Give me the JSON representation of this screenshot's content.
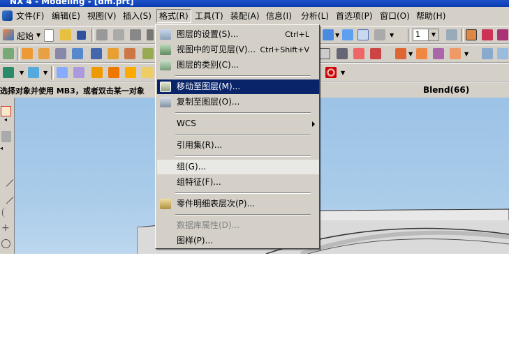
{
  "window": {
    "title": "NX 4 - Modeling - [dm.prt]"
  },
  "menubar": {
    "items": [
      "文件(F)",
      "编辑(E)",
      "视图(V)",
      "插入(S)",
      "格式(R)",
      "工具(T)",
      "装配(A)",
      "信息(I)",
      "分析(L)",
      "首选项(P)",
      "窗口(O)",
      "帮助(H)"
    ],
    "open_item": "格式(R)"
  },
  "toolbar1": {
    "start_label": "起始",
    "layer_value": "1"
  },
  "status": {
    "prompt": "选择对象并使用 MB3，或者双击某一对象",
    "selection_info": "Blend(66)"
  },
  "format_menu": {
    "items": [
      {
        "label": "图层的设置(S)...",
        "shortcut": "Ctrl+L",
        "icon": "layer-settings-icon"
      },
      {
        "label": "视图中的可见层(V)...",
        "shortcut": "Ctrl+Shift+V",
        "icon": "visible-layers-icon"
      },
      {
        "label": "图层的类别(C)...",
        "shortcut": "",
        "icon": "layer-category-icon"
      },
      {
        "label": "移动至图层(M)...",
        "shortcut": "",
        "icon": "move-to-layer-icon",
        "highlighted": true
      },
      {
        "label": "复制至图层(O)...",
        "shortcut": "",
        "icon": "copy-to-layer-icon"
      },
      {
        "label": "WCS",
        "shortcut": "",
        "submenu": true
      },
      {
        "label": "引用集(R)...",
        "shortcut": ""
      },
      {
        "label": "组(G)...",
        "shortcut": ""
      },
      {
        "label": "组特征(F)...",
        "shortcut": ""
      },
      {
        "label": "零件明细表层次(P)...",
        "shortcut": "",
        "icon": "parts-list-levels-icon"
      },
      {
        "label": "数据库属性(D)...",
        "shortcut": "",
        "disabled": true
      },
      {
        "label": "图样(P)...",
        "shortcut": ""
      }
    ]
  },
  "colors": {
    "menu_highlight": "#0a246a",
    "viewport_bg": "#a8cbe9",
    "chrome": "#d4d0c8"
  }
}
